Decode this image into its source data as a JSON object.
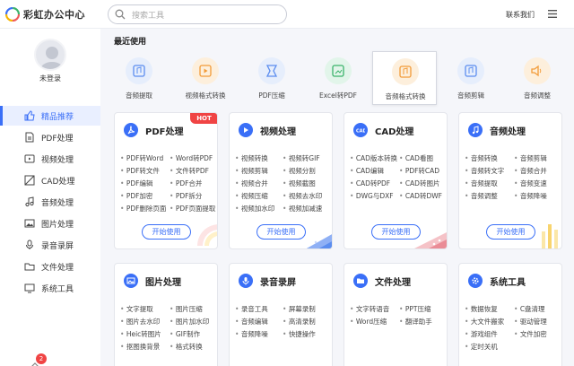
{
  "header": {
    "title": "彩虹办公中心",
    "search_placeholder": "搜索工具",
    "contact": "联系我们"
  },
  "sidebar": {
    "login_label": "未登录",
    "items": [
      {
        "label": "精品推荐",
        "icon": "thumbs-up-icon",
        "active": true
      },
      {
        "label": "PDF处理",
        "icon": "pdf-icon"
      },
      {
        "label": "视频处理",
        "icon": "video-icon"
      },
      {
        "label": "CAD处理",
        "icon": "cad-icon"
      },
      {
        "label": "音频处理",
        "icon": "music-icon"
      },
      {
        "label": "图片处理",
        "icon": "image-icon"
      },
      {
        "label": "录音录屏",
        "icon": "mic-icon"
      },
      {
        "label": "文件处理",
        "icon": "folder-icon"
      },
      {
        "label": "系统工具",
        "icon": "monitor-icon"
      }
    ],
    "notification_count": "2"
  },
  "recent": {
    "title": "最近使用",
    "items": [
      {
        "label": "音频提取",
        "color": "#5b8def"
      },
      {
        "label": "视频格式转换",
        "color": "#f29b38"
      },
      {
        "label": "PDF压缩",
        "color": "#5b8def"
      },
      {
        "label": "Excel转PDF",
        "color": "#3bb36b"
      },
      {
        "label": "音频格式转换",
        "color": "#f29b38"
      },
      {
        "label": "音频剪辑",
        "color": "#5b8def"
      },
      {
        "label": "音频调整",
        "color": "#f29b38"
      }
    ]
  },
  "cards": [
    {
      "title": "PDF处理",
      "hot": "HOT",
      "features": [
        "PDF转Word",
        "Word转PDF",
        "PDF转文件",
        "文件转PDF",
        "PDF编辑",
        "PDF合并",
        "PDF加密",
        "PDF拆分",
        "PDF删除页面",
        "PDF页面提取"
      ],
      "button": "开始使用"
    },
    {
      "title": "视频处理",
      "features": [
        "视频转换",
        "视频转GIF",
        "视频剪辑",
        "视频分割",
        "视频合并",
        "视频截图",
        "视频压缩",
        "视频去水印",
        "视频加水印",
        "视频加减速"
      ],
      "button": "开始使用"
    },
    {
      "title": "CAD处理",
      "features": [
        "CAD版本转换",
        "CAD看图",
        "CAD编辑",
        "PDF转CAD",
        "CAD转PDF",
        "CAD转图片",
        "DWG与DXF",
        "CAD转DWF"
      ],
      "button": "开始使用"
    },
    {
      "title": "音频处理",
      "features": [
        "音频转换",
        "音频剪辑",
        "音频转文字",
        "音频合并",
        "音频提取",
        "音频变速",
        "音频调整",
        "音频降噪"
      ],
      "button": "开始使用"
    },
    {
      "title": "图片处理",
      "features": [
        "文字提取",
        "图片压缩",
        "图片去水印",
        "图片加水印",
        "Heic转图片",
        "GIF制作",
        "抠图换背景",
        "格式转换"
      ]
    },
    {
      "title": "录音录屏",
      "features": [
        "录音工具",
        "屏幕录制",
        "音频编辑",
        "高清录制",
        "音频降噪",
        "快捷操作"
      ]
    },
    {
      "title": "文件处理",
      "features": [
        "文字转语音",
        "PPT压缩",
        "Word压缩",
        "翻译助手"
      ]
    },
    {
      "title": "系统工具",
      "features": [
        "数据恢复",
        "C盘清理",
        "大文件搬家",
        "驱动管理",
        "游戏组件",
        "文件加密",
        "定时关机"
      ]
    }
  ]
}
